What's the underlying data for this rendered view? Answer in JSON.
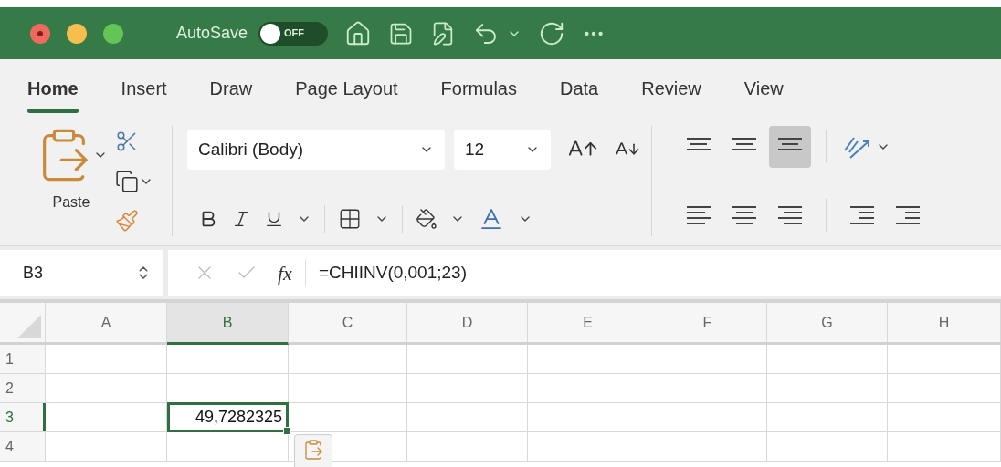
{
  "title_bar": {
    "autosave_label": "AutoSave",
    "autosave_toggle": {
      "text": "OFF",
      "on": false
    }
  },
  "tabs": [
    {
      "label": "Home",
      "selected": true
    },
    {
      "label": "Insert",
      "selected": false
    },
    {
      "label": "Draw",
      "selected": false
    },
    {
      "label": "Page Layout",
      "selected": false
    },
    {
      "label": "Formulas",
      "selected": false
    },
    {
      "label": "Data",
      "selected": false
    },
    {
      "label": "Review",
      "selected": false
    },
    {
      "label": "View",
      "selected": false
    }
  ],
  "ribbon": {
    "paste_label": "Paste",
    "font_name": "Calibri (Body)",
    "font_size": "12",
    "vertical_align": [
      {
        "selected": false
      },
      {
        "selected": false
      },
      {
        "selected": true
      }
    ]
  },
  "formula_bar": {
    "name_box": "B3",
    "function_label": "fx",
    "formula": "=CHIINV(0,001;23)"
  },
  "grid": {
    "columns": [
      {
        "label": "A",
        "selected": false
      },
      {
        "label": "B",
        "selected": true
      },
      {
        "label": "C",
        "selected": false
      },
      {
        "label": "D",
        "selected": false
      },
      {
        "label": "E",
        "selected": false
      },
      {
        "label": "F",
        "selected": false
      },
      {
        "label": "G",
        "selected": false
      },
      {
        "label": "H",
        "selected": false
      }
    ],
    "rows": [
      {
        "label": "1",
        "selected": false
      },
      {
        "label": "2",
        "selected": false
      },
      {
        "label": "3",
        "selected": true
      },
      {
        "label": "4",
        "selected": false
      }
    ],
    "active_cell_value": "49,7282325"
  }
}
